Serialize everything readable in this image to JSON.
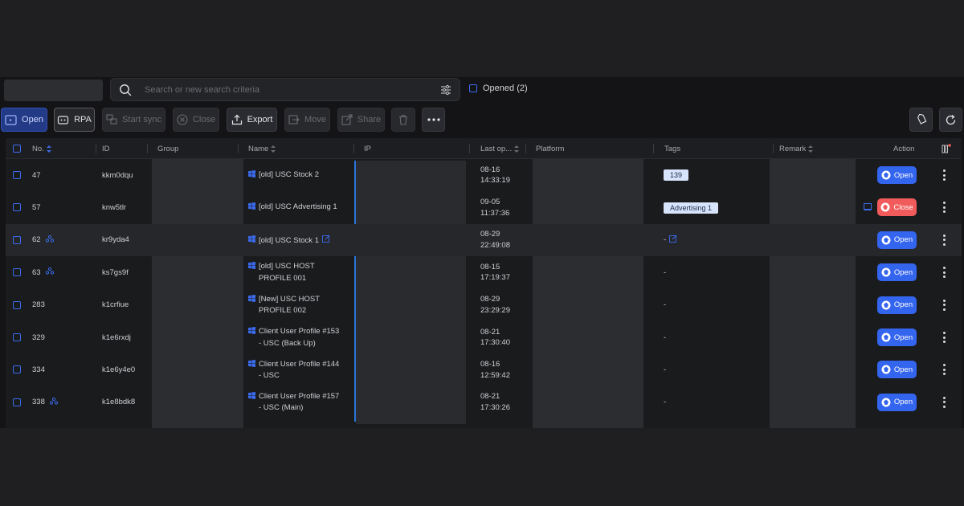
{
  "search": {
    "placeholder": "Search or new search criteria"
  },
  "opened_filter": {
    "label": "Opened (2)"
  },
  "toolbar": {
    "open": "Open",
    "rpa": "RPA",
    "start_sync": "Start sync",
    "close": "Close",
    "export": "Export",
    "move": "Move",
    "share": "Share"
  },
  "columns": {
    "no": "No.",
    "id": "ID",
    "group": "Group",
    "name": "Name",
    "ip": "IP",
    "last_opened": "Last op...",
    "platform": "Platform",
    "tags": "Tags",
    "remark": "Remark",
    "action": "Action"
  },
  "rows": [
    {
      "no": "47",
      "id": "kkm0dqu",
      "name_l1": "[old] USC Stock 2",
      "name_l2": "",
      "date": "08-16",
      "time": "14:33:19",
      "tag": "139",
      "action": "Open",
      "shared": false
    },
    {
      "no": "57",
      "id": "knw5tlr",
      "name_l1": "[old] USC Advertising 1",
      "name_l2": "",
      "date": "09-05",
      "time": "11:37:36",
      "tag": "Advertising 1",
      "action": "Close",
      "shared": false
    },
    {
      "no": "62",
      "id": "kr9yda4",
      "name_l1": "[old] USC Stock 1",
      "name_l2": "",
      "date": "08-29",
      "time": "22:49:08",
      "tag": "-",
      "action": "Open",
      "shared": true
    },
    {
      "no": "63",
      "id": "ks7gs9f",
      "name_l1": "[old] USC HOST",
      "name_l2": "PROFILE 001",
      "date": "08-15",
      "time": "17:19:37",
      "tag": "-",
      "action": "Open",
      "shared": true
    },
    {
      "no": "283",
      "id": "k1crfiue",
      "name_l1": "[New] USC HOST",
      "name_l2": "PROFILE 002",
      "date": "08-29",
      "time": "23:29:29",
      "tag": "-",
      "action": "Open",
      "shared": false
    },
    {
      "no": "329",
      "id": "k1e6rxdj",
      "name_l1": "Client User Profile #153",
      "name_l2": "- USC (Back Up)",
      "date": "08-21",
      "time": "17:30:40",
      "tag": "-",
      "action": "Open",
      "shared": false
    },
    {
      "no": "334",
      "id": "k1e6y4e0",
      "name_l1": "Client User Profile #144",
      "name_l2": "- USC",
      "date": "08-16",
      "time": "12:59:42",
      "tag": "-",
      "action": "Open",
      "shared": false
    },
    {
      "no": "338",
      "id": "k1e8bdk8",
      "name_l1": "Client User Profile #157",
      "name_l2": "- USC (Main)",
      "date": "08-21",
      "time": "17:30:26",
      "tag": "-",
      "action": "Open",
      "shared": true
    }
  ]
}
